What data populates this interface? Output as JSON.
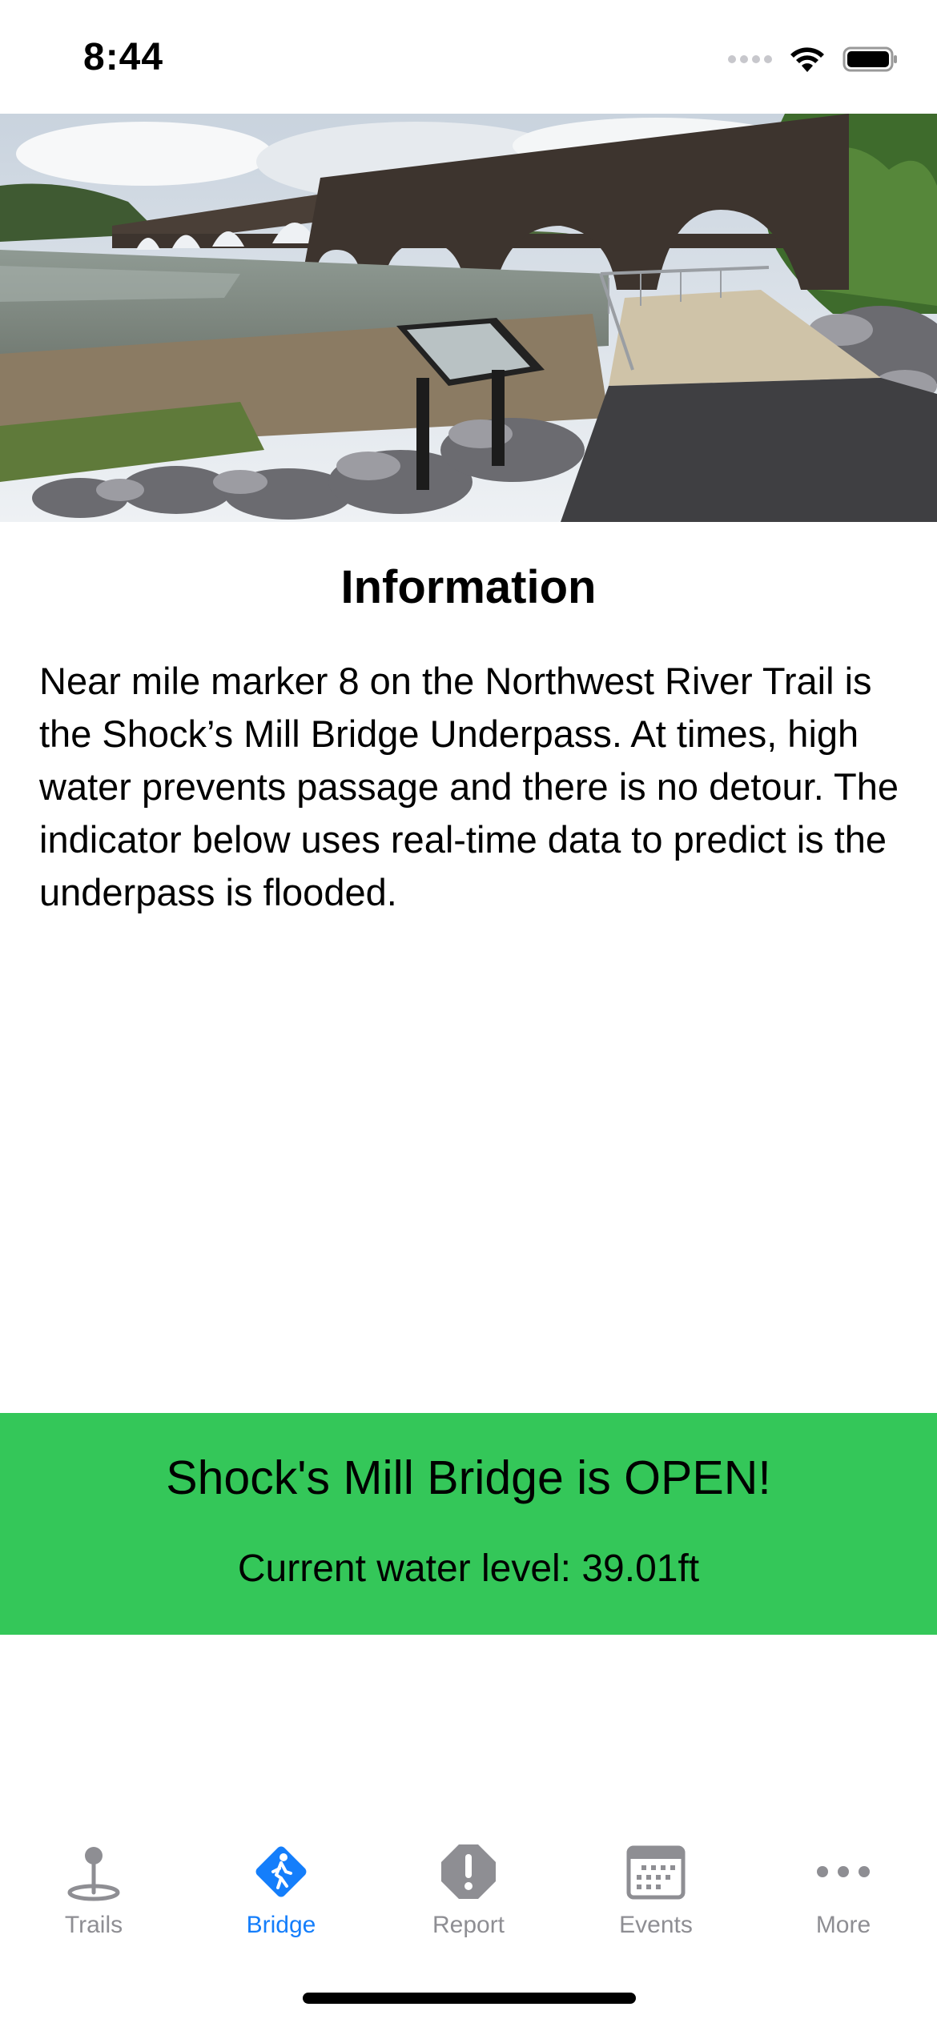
{
  "status_bar": {
    "time": "8:44"
  },
  "hero": {
    "subject": "stone arch bridge over river with trail underpass"
  },
  "info": {
    "title": "Information",
    "body": "Near mile marker 8 on the Northwest River Trail is the Shock’s Mill Bridge Underpass. At times, high water prevents passage and there is no detour. The indicator below uses real-time data to predict is the underpass is flooded."
  },
  "bridge_status": {
    "headline": "Shock's Mill Bridge is OPEN!",
    "water_level": "Current water level: 39.01ft",
    "color": "#34c759"
  },
  "tab_bar": {
    "active_color": "#147efb",
    "inactive_color": "#8e8e93",
    "tabs": [
      {
        "label": "Trails",
        "icon": "map-pin-icon",
        "active": false
      },
      {
        "label": "Bridge",
        "icon": "walking-sign-icon",
        "active": true
      },
      {
        "label": "Report",
        "icon": "alert-octagon-icon",
        "active": false
      },
      {
        "label": "Events",
        "icon": "calendar-icon",
        "active": false
      },
      {
        "label": "More",
        "icon": "more-dots-icon",
        "active": false
      }
    ]
  }
}
